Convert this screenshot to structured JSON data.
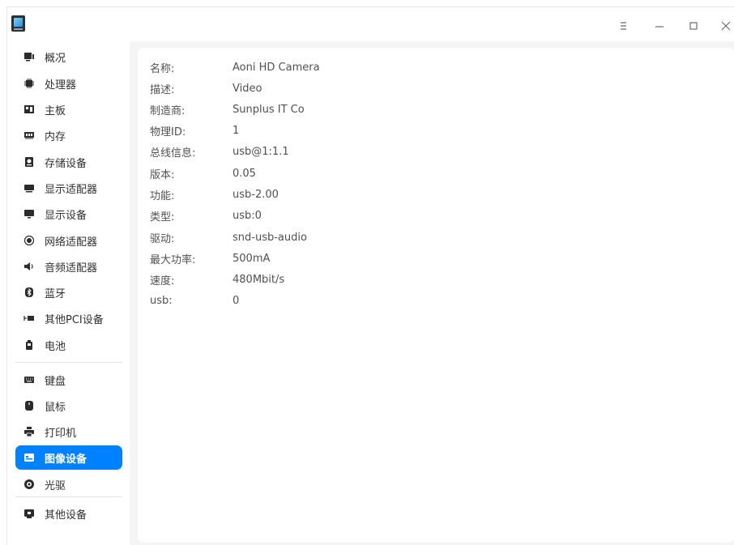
{
  "window": {
    "icons": {
      "app": "device-manager-app-icon",
      "menu": "hamburger-menu-icon",
      "minimize": "minimize-icon",
      "maximize": "maximize-icon",
      "close": "close-icon"
    }
  },
  "sidebar": {
    "items": [
      {
        "label": "概况",
        "icon": "overview-icon"
      },
      {
        "label": "处理器",
        "icon": "cpu-icon"
      },
      {
        "label": "主板",
        "icon": "motherboard-icon"
      },
      {
        "label": "内存",
        "icon": "memory-icon"
      },
      {
        "label": "存储设备",
        "icon": "storage-icon"
      },
      {
        "label": "显示适配器",
        "icon": "display-adapter-icon"
      },
      {
        "label": "显示设备",
        "icon": "monitor-icon"
      },
      {
        "label": "网络适配器",
        "icon": "network-icon"
      },
      {
        "label": "音频适配器",
        "icon": "audio-icon"
      },
      {
        "label": "蓝牙",
        "icon": "bluetooth-icon"
      },
      {
        "label": "其他PCI设备",
        "icon": "pci-icon"
      },
      {
        "label": "电池",
        "icon": "battery-icon"
      },
      {
        "label": "键盘",
        "icon": "keyboard-icon"
      },
      {
        "label": "鼠标",
        "icon": "mouse-icon"
      },
      {
        "label": "打印机",
        "icon": "printer-icon"
      },
      {
        "label": "图像设备",
        "icon": "camera-icon",
        "active": true
      },
      {
        "label": "光驱",
        "icon": "optical-drive-icon"
      },
      {
        "label": "其他设备",
        "icon": "other-devices-icon"
      }
    ]
  },
  "details": {
    "rows": [
      {
        "key": "名称:",
        "value": "Aoni HD Camera"
      },
      {
        "key": "描述:",
        "value": "Video"
      },
      {
        "key": "制造商:",
        "value": "Sunplus IT Co"
      },
      {
        "key": "物理ID:",
        "value": "1"
      },
      {
        "key": "总线信息:",
        "value": "usb@1:1.1"
      },
      {
        "key": "版本:",
        "value": "0.05"
      },
      {
        "key": "功能:",
        "value": "usb-2.00"
      },
      {
        "key": "类型:",
        "value": "usb:0"
      },
      {
        "key": "驱动:",
        "value": "snd-usb-audio"
      },
      {
        "key": "最大功率:",
        "value": "500mA"
      },
      {
        "key": "速度:",
        "value": "480Mbit/s"
      },
      {
        "key": "usb:",
        "value": "0"
      }
    ]
  },
  "colors": {
    "accent": "#0081ff",
    "content_bg": "#f5f5f5",
    "icon": "#2b2b2b"
  }
}
